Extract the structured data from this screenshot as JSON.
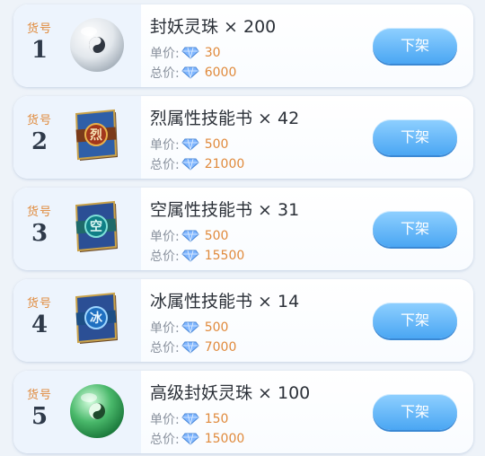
{
  "items": [
    {
      "slot_label": "货号",
      "slot_number": "1",
      "name": "封妖灵珠 × 200",
      "unit_price_label": "单价:",
      "unit_price": "30",
      "total_price_label": "总价:",
      "total_price": "6000",
      "action_label": "下架",
      "icon": "taiji-orb-white-icon"
    },
    {
      "slot_label": "货号",
      "slot_number": "2",
      "name": "烈属性技能书 × 42",
      "unit_price_label": "单价:",
      "unit_price": "500",
      "total_price_label": "总价:",
      "total_price": "21000",
      "action_label": "下架",
      "icon": "fire-skill-book-icon",
      "book_glyph": "烈"
    },
    {
      "slot_label": "货号",
      "slot_number": "3",
      "name": "空属性技能书 × 31",
      "unit_price_label": "单价:",
      "unit_price": "500",
      "total_price_label": "总价:",
      "total_price": "15500",
      "action_label": "下架",
      "icon": "void-skill-book-icon",
      "book_glyph": "空"
    },
    {
      "slot_label": "货号",
      "slot_number": "4",
      "name": "冰属性技能书 × 14",
      "unit_price_label": "单价:",
      "unit_price": "500",
      "total_price_label": "总价:",
      "total_price": "7000",
      "action_label": "下架",
      "icon": "ice-skill-book-icon",
      "book_glyph": "冰"
    },
    {
      "slot_label": "货号",
      "slot_number": "5",
      "name": "高级封妖灵珠 × 100",
      "unit_price_label": "单价:",
      "unit_price": "150",
      "total_price_label": "总价:",
      "total_price": "15000",
      "action_label": "下架",
      "icon": "taiji-orb-green-icon"
    }
  ],
  "colors": {
    "accent_orange": "#e08a3c",
    "button_blue": "#4aa6f3",
    "gem_blue": "#7fb6ff"
  }
}
